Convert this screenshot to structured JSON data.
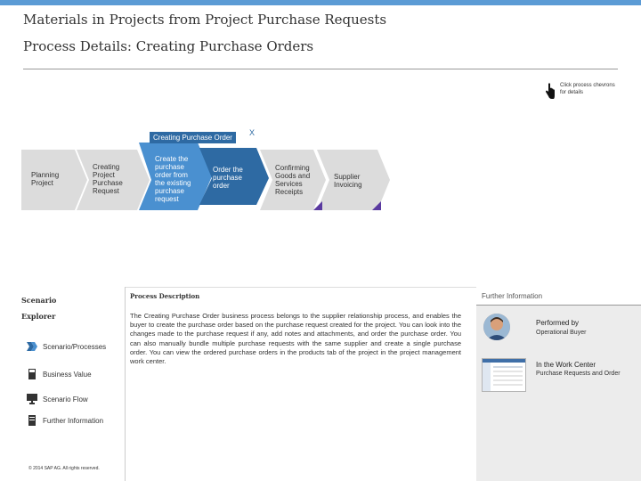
{
  "header": {
    "title": "Materials in Projects from Project Purchase Requests",
    "subtitle": "Process Details: Creating Purchase Orders"
  },
  "hint": {
    "text": "Click process chevrons for details",
    "icon": "hand-pointer-icon"
  },
  "process": {
    "group_label": "Creating Purchase Order",
    "group_close": "X",
    "steps": [
      {
        "label": "Planning Project",
        "state": "inactive"
      },
      {
        "label": "Creating Project Purchase Request",
        "state": "inactive"
      },
      {
        "label": "Create the purchase order from the existing purchase request",
        "state": "active"
      },
      {
        "label": "Order the purchase order",
        "state": "active-selected"
      },
      {
        "label": "Confirming Goods and Services Receipts",
        "state": "inactive"
      },
      {
        "label": "Supplier Invoicing",
        "state": "inactive"
      }
    ],
    "colors": {
      "inactive": "#dcdcdc",
      "active": "#4a90d0",
      "selected": "#2e6aa3",
      "marker": "#5a3aa0"
    }
  },
  "explorer": {
    "title_line1": "Scenario",
    "title_line2": "Explorer",
    "items": [
      {
        "label": "Scenario/Processes",
        "icon": "chevrons-icon"
      },
      {
        "label": "Business Value",
        "icon": "calculator-icon"
      },
      {
        "label": "Scenario Flow",
        "icon": "monitor-icon"
      },
      {
        "label": "Further Information",
        "icon": "document-icon"
      }
    ],
    "copyright": "© 2014 SAP AG. All rights reserved."
  },
  "description": {
    "title": "Process Description",
    "body": "The Creating Purchase Order business process belongs to the supplier relationship process, and enables the buyer to create the purchase order based on the purchase request created for the project. You can look into the changes made to the purchase request if any, add notes and attachments, and order the purchase order. You can also manually bundle multiple purchase requests with the same supplier and create a single purchase order. You can view the ordered purchase orders in the products tab of the project in the project management work center."
  },
  "further_info": {
    "title": "Further Information",
    "performed_by_label": "Performed by",
    "performed_by_value": "Operational Buyer",
    "work_center_label": "In the Work Center",
    "work_center_value": "Purchase Requests and Order"
  }
}
